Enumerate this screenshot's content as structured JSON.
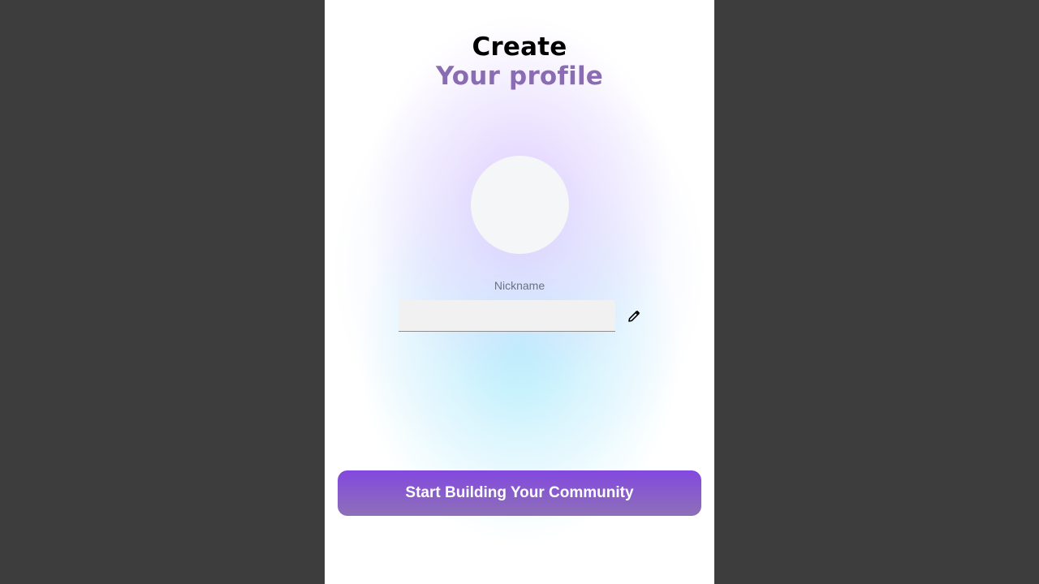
{
  "header": {
    "line1": "Create",
    "line2": "Your profile"
  },
  "avatar": {
    "icon": "avatar-placeholder"
  },
  "nickname": {
    "label": "Nickname",
    "value": "",
    "placeholder": "",
    "edit_icon": "pencil-icon"
  },
  "cta": {
    "label": "Start Building Your Community"
  },
  "colors": {
    "backdrop": "#3d3d3d",
    "accent": "#8348df",
    "subtitle": "#8a6cb3",
    "avatar_fill": "#f5f6f8",
    "input_fill": "#f1f1f1"
  }
}
